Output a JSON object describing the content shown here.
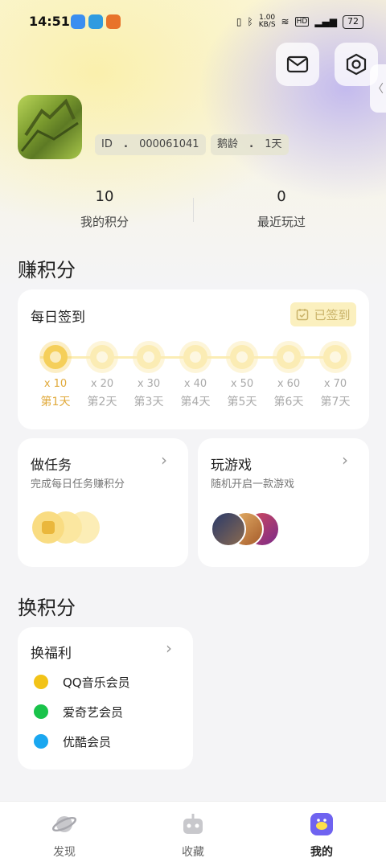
{
  "status_bar": {
    "time": "14:51",
    "network_speed": "1.00\nKB/S",
    "battery": "72"
  },
  "profile": {
    "id_label": "ID",
    "id_value": "000061041",
    "age_label": "鹅龄",
    "age_value": "1天"
  },
  "stats": [
    {
      "value": "10",
      "label": "我的积分"
    },
    {
      "value": "0",
      "label": "最近玩过"
    }
  ],
  "earn": {
    "title": "赚积分",
    "checkin": {
      "title": "每日签到",
      "signed_label": "已签到",
      "days": [
        {
          "mult": "x 10",
          "label": "第1天",
          "active": true
        },
        {
          "mult": "x 20",
          "label": "第2天",
          "active": false
        },
        {
          "mult": "x 30",
          "label": "第3天",
          "active": false
        },
        {
          "mult": "x 40",
          "label": "第4天",
          "active": false
        },
        {
          "mult": "x 50",
          "label": "第5天",
          "active": false
        },
        {
          "mult": "x 60",
          "label": "第6天",
          "active": false
        },
        {
          "mult": "x 70",
          "label": "第7天",
          "active": false
        }
      ]
    },
    "tasks": {
      "title": "做任务",
      "subtitle": "完成每日任务赚积分"
    },
    "games": {
      "title": "玩游戏",
      "subtitle": "随机开启一款游戏"
    }
  },
  "exchange": {
    "title": "换积分",
    "card_title": "换福利",
    "items": [
      {
        "label": "QQ音乐会员",
        "icon": "qq-music-icon",
        "color": "#f2c318"
      },
      {
        "label": "爱奇艺会员",
        "icon": "iqiyi-icon",
        "color": "#19c34a"
      },
      {
        "label": "优酷会员",
        "icon": "youku-icon",
        "color": "#1aa7f0"
      }
    ]
  },
  "bottom_nav": [
    {
      "label": "发现",
      "icon": "planet-icon"
    },
    {
      "label": "收藏",
      "icon": "robot-icon"
    },
    {
      "label": "我的",
      "icon": "penguin-icon",
      "active": true
    }
  ],
  "colors": {
    "accent": "#e0a93a",
    "coin_active": "#f5cf5a",
    "nav_active": "#6f63f0"
  }
}
